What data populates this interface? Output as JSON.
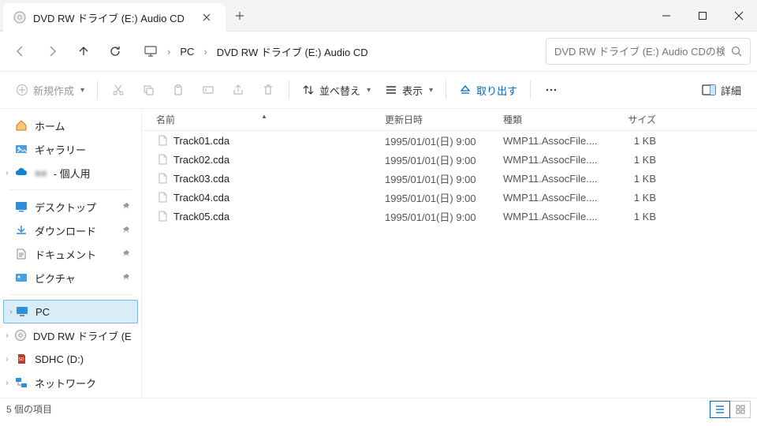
{
  "tab": {
    "title": "DVD RW ドライブ (E:) Audio CD"
  },
  "breadcrumb": {
    "root": "PC",
    "current": "DVD RW ドライブ (E:) Audio CD"
  },
  "search": {
    "placeholder": "DVD RW ドライブ (E:) Audio CDの検"
  },
  "toolbar": {
    "new": "新規作成",
    "sort": "並べ替え",
    "view": "表示",
    "eject": "取り出す",
    "details": "詳細"
  },
  "sidebar": {
    "home": "ホーム",
    "gallery": "ギャラリー",
    "personal": "- 個人用",
    "desktop": "デスクトップ",
    "downloads": "ダウンロード",
    "documents": "ドキュメント",
    "pictures": "ピクチャ",
    "pc": "PC",
    "dvd": "DVD RW ドライブ (E:) A",
    "sdhc": "SDHC (D:)",
    "network": "ネットワーク"
  },
  "columns": {
    "name": "名前",
    "date": "更新日時",
    "type": "種類",
    "size": "サイズ"
  },
  "files": [
    {
      "name": "Track01.cda",
      "date": "1995/01/01(日) 9:00",
      "type": "WMP11.AssocFile....",
      "size": "1 KB"
    },
    {
      "name": "Track02.cda",
      "date": "1995/01/01(日) 9:00",
      "type": "WMP11.AssocFile....",
      "size": "1 KB"
    },
    {
      "name": "Track03.cda",
      "date": "1995/01/01(日) 9:00",
      "type": "WMP11.AssocFile....",
      "size": "1 KB"
    },
    {
      "name": "Track04.cda",
      "date": "1995/01/01(日) 9:00",
      "type": "WMP11.AssocFile....",
      "size": "1 KB"
    },
    {
      "name": "Track05.cda",
      "date": "1995/01/01(日) 9:00",
      "type": "WMP11.AssocFile....",
      "size": "1 KB"
    }
  ],
  "status": {
    "count": "5 個の項目"
  }
}
